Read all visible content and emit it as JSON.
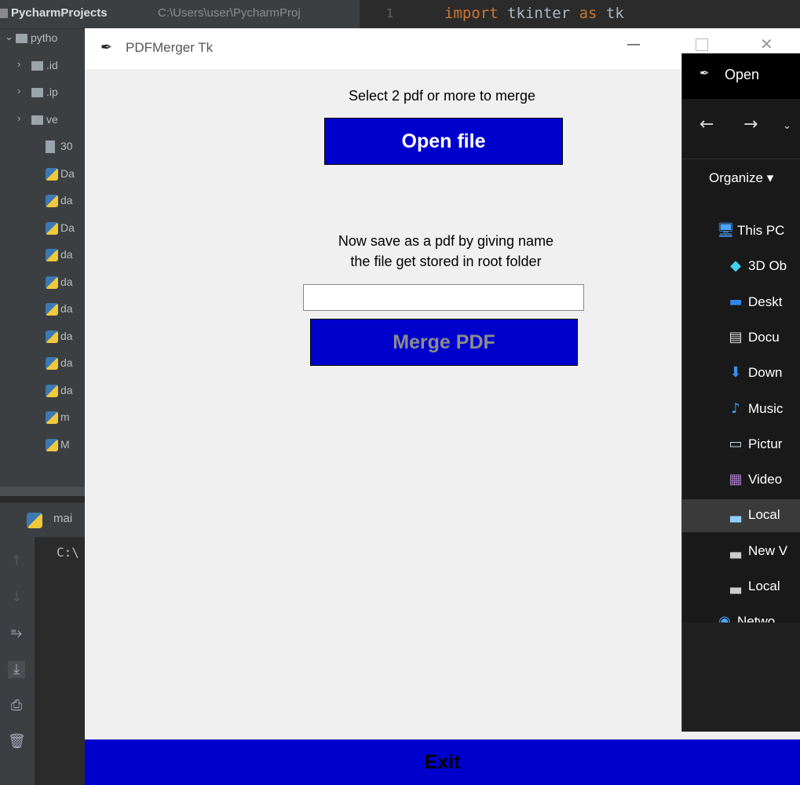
{
  "ide": {
    "project_name": "PycharmProjects",
    "project_path": "C:\\Users\\user\\PycharmProj",
    "line_number": "1",
    "code_keyword": "import",
    "code_module": " tkinter ",
    "code_as": "as",
    "code_alias": " tk",
    "tree": [
      {
        "label": "pytho",
        "type": "folder",
        "arrow": "⌄"
      },
      {
        "label": ".id",
        "type": "folder",
        "arrow": "›"
      },
      {
        "label": ".ip",
        "type": "folder",
        "arrow": "›"
      },
      {
        "label": "ve",
        "type": "folder",
        "arrow": "›"
      },
      {
        "label": "30",
        "type": "doc",
        "arrow": ""
      },
      {
        "label": "Da",
        "type": "py",
        "arrow": ""
      },
      {
        "label": "da",
        "type": "py",
        "arrow": ""
      },
      {
        "label": "Da",
        "type": "py",
        "arrow": ""
      },
      {
        "label": "da",
        "type": "py",
        "arrow": ""
      },
      {
        "label": "da",
        "type": "py",
        "arrow": ""
      },
      {
        "label": "da",
        "type": "py",
        "arrow": ""
      },
      {
        "label": "da",
        "type": "py",
        "arrow": ""
      },
      {
        "label": "da",
        "type": "py",
        "arrow": ""
      },
      {
        "label": "da",
        "type": "py",
        "arrow": ""
      },
      {
        "label": "m",
        "type": "py",
        "arrow": ""
      },
      {
        "label": "M",
        "type": "py",
        "arrow": ""
      }
    ],
    "run_tab_label": "mai",
    "console_text": "C:\\"
  },
  "tk": {
    "title": "PDFMerger Tk",
    "instruction_select": "Select 2 pdf or more to merge",
    "open_button": "Open file",
    "instruction_save_line1": "Now save as a pdf by giving name",
    "instruction_save_line2": "the file get stored in root folder",
    "filename_value": "",
    "merge_button": "Merge PDF",
    "exit_button": "Exit"
  },
  "dialog": {
    "title": "Open",
    "organize_label": "Organize ▾",
    "items": [
      {
        "label": "This PC",
        "icon": "monitor-icon",
        "glyph": "🖥",
        "color": "#4aa3ff",
        "indent": 0
      },
      {
        "label": "3D Ob",
        "icon": "cube-icon",
        "glyph": "◆",
        "color": "#3fd2f0",
        "indent": 1
      },
      {
        "label": "Deskt",
        "icon": "desktop-icon",
        "glyph": "▬",
        "color": "#2f86e8",
        "indent": 1
      },
      {
        "label": "Docu",
        "icon": "document-icon",
        "glyph": "▤",
        "color": "#dddddd",
        "indent": 1
      },
      {
        "label": "Down",
        "icon": "download-icon",
        "glyph": "⬇",
        "color": "#3a8ef0",
        "indent": 1
      },
      {
        "label": "Music",
        "icon": "music-icon",
        "glyph": "♪",
        "color": "#3aa0ff",
        "indent": 1
      },
      {
        "label": "Pictur",
        "icon": "pictures-icon",
        "glyph": "▭",
        "color": "#cfd8e0",
        "indent": 1
      },
      {
        "label": "Video",
        "icon": "video-icon",
        "glyph": "▦",
        "color": "#a57ac8",
        "indent": 1
      },
      {
        "label": "Local",
        "icon": "local-disk-icon",
        "glyph": "▃",
        "color": "#8ed0ff",
        "indent": 1,
        "selected": true
      },
      {
        "label": "New V",
        "icon": "drive-icon",
        "glyph": "▃",
        "color": "#cccccc",
        "indent": 1
      },
      {
        "label": "Local",
        "icon": "drive-icon",
        "glyph": "▃",
        "color": "#cccccc",
        "indent": 1
      },
      {
        "label": "Netwo",
        "icon": "network-icon",
        "glyph": "◉",
        "color": "#4aa3ff",
        "indent": 0
      }
    ]
  }
}
